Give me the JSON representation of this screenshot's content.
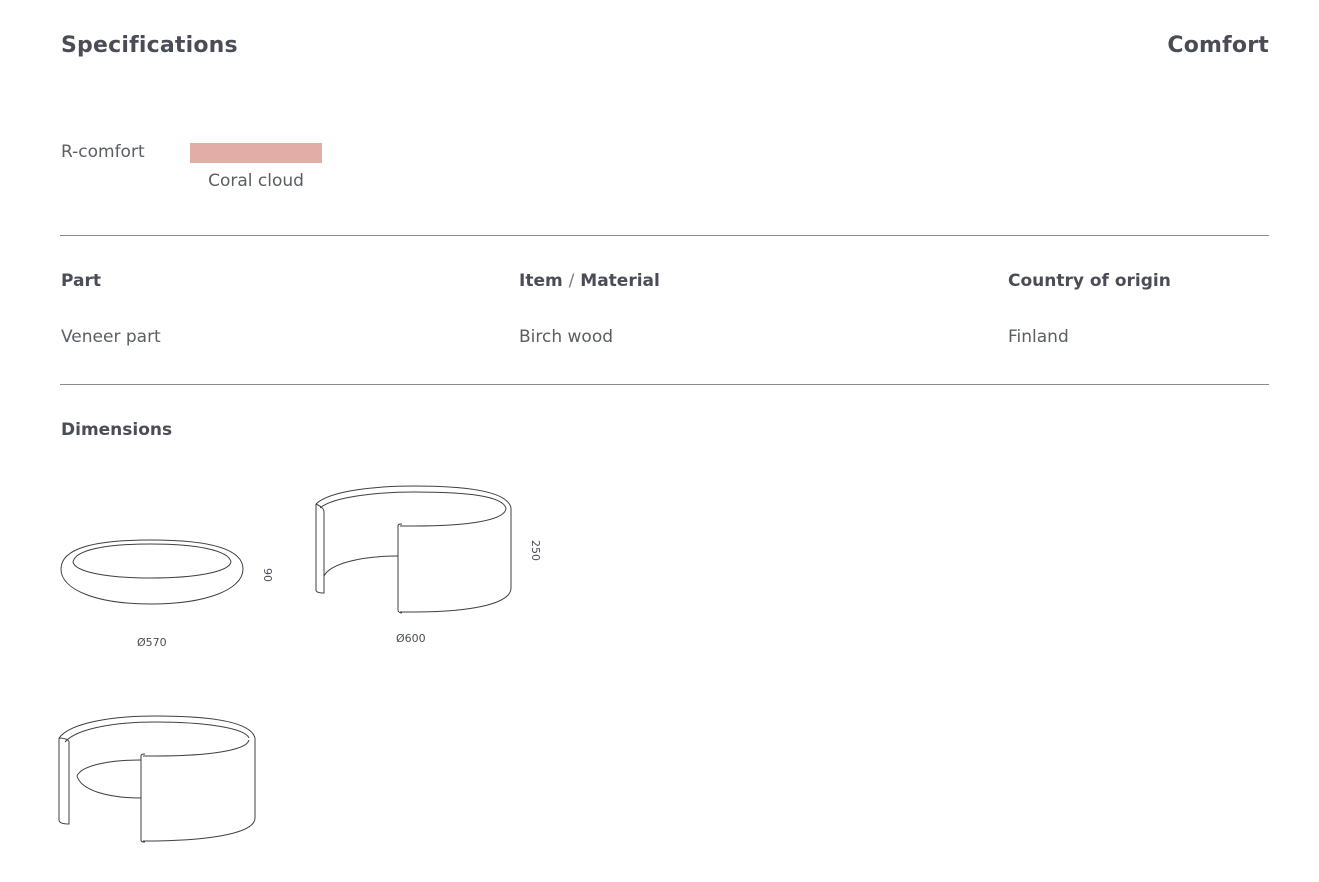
{
  "header": {
    "title": "Specifications",
    "collection": "Comfort"
  },
  "variant": {
    "name": "R-comfort",
    "color_name": "Coral cloud",
    "color_hex": "#e2ada6"
  },
  "table": {
    "headers": {
      "part": "Part",
      "item": "Item",
      "separator": "/",
      "material": "Material",
      "origin": "Country of origin"
    },
    "rows": [
      {
        "part": "Veneer part",
        "material": "Birch wood",
        "origin": "Finland"
      }
    ]
  },
  "dimensions": {
    "title": "Dimensions",
    "drawings": [
      {
        "name": "cushion",
        "diameter_label": "Ø570",
        "height_label": "90"
      },
      {
        "name": "open-shell-side",
        "diameter_label": "Ø600",
        "height_label": "250"
      },
      {
        "name": "open-shell-perspective"
      }
    ]
  }
}
